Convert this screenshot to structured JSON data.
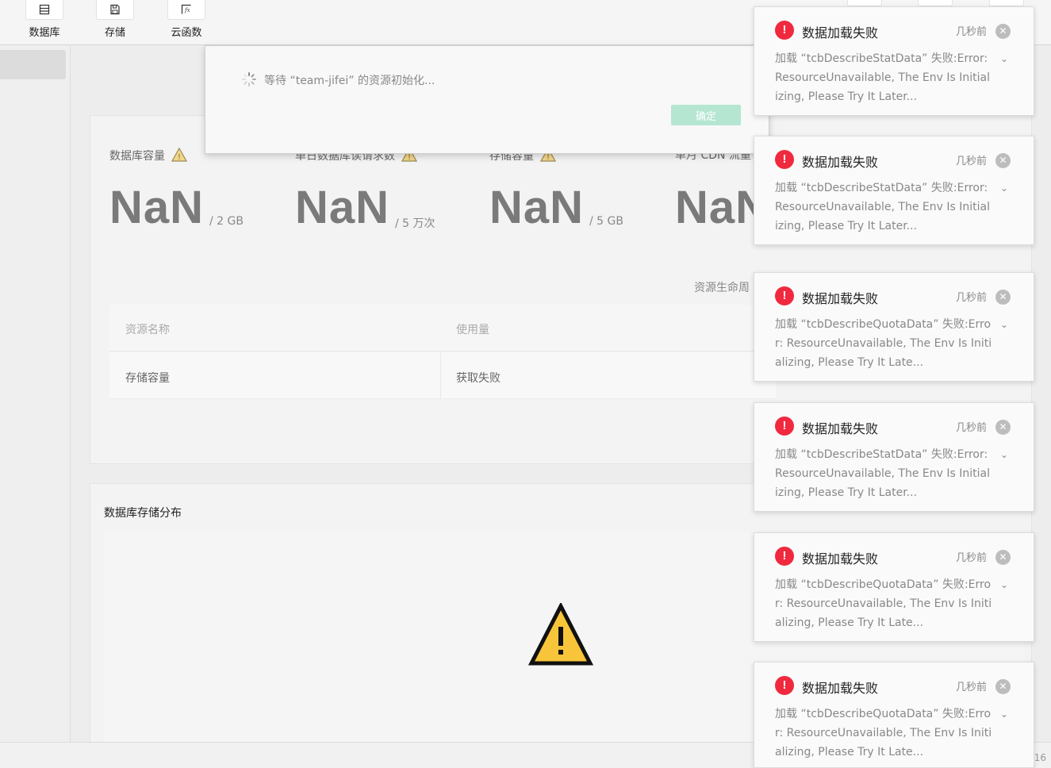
{
  "toolbar": {
    "items": [
      {
        "label": "数据库",
        "icon": "database-icon"
      },
      {
        "label": "存储",
        "icon": "storage-icon"
      },
      {
        "label": "云函数",
        "icon": "cloud-function-icon"
      }
    ],
    "fx_glyph": "fx"
  },
  "stats": [
    {
      "label": "数据库容量",
      "value": "NaN",
      "unit": "/ 2 GB"
    },
    {
      "label": "单日数据库读请求数",
      "value": "NaN",
      "unit": "/ 5 万次"
    },
    {
      "label": "存储容量",
      "value": "NaN",
      "unit": "/ 5 GB"
    },
    {
      "label": "单月 CDN 流量",
      "value": "NaN",
      "unit": ""
    }
  ],
  "lifecycle_link": "资源生命周",
  "table": {
    "headers": [
      "资源名称",
      "使用量"
    ],
    "rows": [
      [
        "存储容量",
        "获取失败"
      ]
    ]
  },
  "storage_dist": {
    "title": "数据库存储分布"
  },
  "dialog": {
    "message": "等待 “team-jifei” 的资源初始化...",
    "confirm_label": "确定"
  },
  "notifications": [
    {
      "title": "数据加载失败",
      "time": "几秒前",
      "body": "加载 “tcbDescribeStatData” 失败:Error: ResourceUnavailable, The Env Is Initializing, Please Try It Later..."
    },
    {
      "title": "数据加载失败",
      "time": "几秒前",
      "body": "加载 “tcbDescribeStatData” 失败:Error: ResourceUnavailable, The Env Is Initializing, Please Try It Later..."
    },
    {
      "title": "数据加载失败",
      "time": "几秒前",
      "body": "加载 “tcbDescribeQuotaData” 失败:Error: ResourceUnavailable, The Env Is Initializing, Please Try It Late..."
    },
    {
      "title": "数据加载失败",
      "time": "几秒前",
      "body": "加载 “tcbDescribeStatData” 失败:Error: ResourceUnavailable, The Env Is Initializing, Please Try It Later..."
    },
    {
      "title": "数据加载失败",
      "time": "几秒前",
      "body": "加载 “tcbDescribeQuotaData” 失败:Error: ResourceUnavailable, The Env Is Initializing, Please Try It Late..."
    },
    {
      "title": "数据加载失败",
      "time": "几秒前",
      "body": "加载 “tcbDescribeQuotaData” 失败:Error: ResourceUnavailable, The Env Is Initializing, Please Try It Late..."
    }
  ],
  "status_bar": {
    "line_number": "16"
  },
  "colors": {
    "accent_button": "#b5e6d2",
    "error_red": "#f0293e",
    "warning_yellow": "#f8c53a"
  }
}
